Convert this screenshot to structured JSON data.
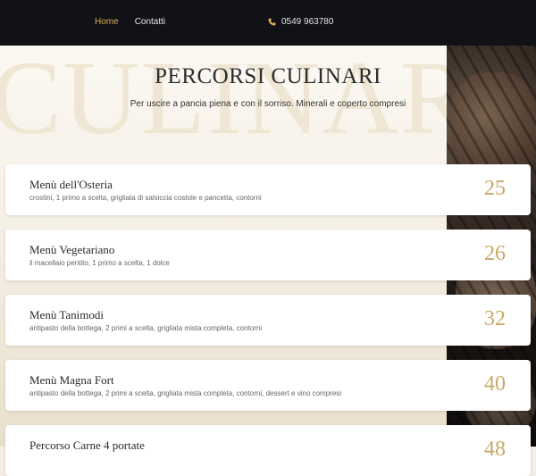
{
  "nav": {
    "items": [
      {
        "label": "Home",
        "active": true
      },
      {
        "label": "Contatti",
        "active": false
      }
    ],
    "phone": "0549 963780",
    "phone_icon": "phone-icon"
  },
  "hero": {
    "watermark": "CULINARI",
    "title": "PERCORSI CULINARI",
    "subtitle": "Per uscire a pancia piena e con il sorriso. Minerali e coperto compresi"
  },
  "colors": {
    "accent": "#d6ae5b",
    "price": "#c8a867",
    "topbar": "#111216"
  },
  "menus": [
    {
      "name": "Menù dell'Osteria",
      "desc": "crostini, 1 primo a scelta, grigliata di salsiccia costole e pancetta, contorni",
      "price": "25"
    },
    {
      "name": "Menù Vegetariano",
      "desc": "il macellaio pentito, 1 primo a scelta, 1 dolce",
      "price": "26"
    },
    {
      "name": "Menù Tanimodi",
      "desc": "antipasto della bottega, 2 primi a scelta, grigliata mista completa, contorni",
      "price": "32"
    },
    {
      "name": "Menù Magna Fort",
      "desc": "antipasto della bottega, 2 primi a scelta, grigliata mista completa, contorni, dessert e vino compresi",
      "price": "40"
    },
    {
      "name": "Percorso Carne 4 portate",
      "desc": "",
      "price": "48"
    }
  ]
}
